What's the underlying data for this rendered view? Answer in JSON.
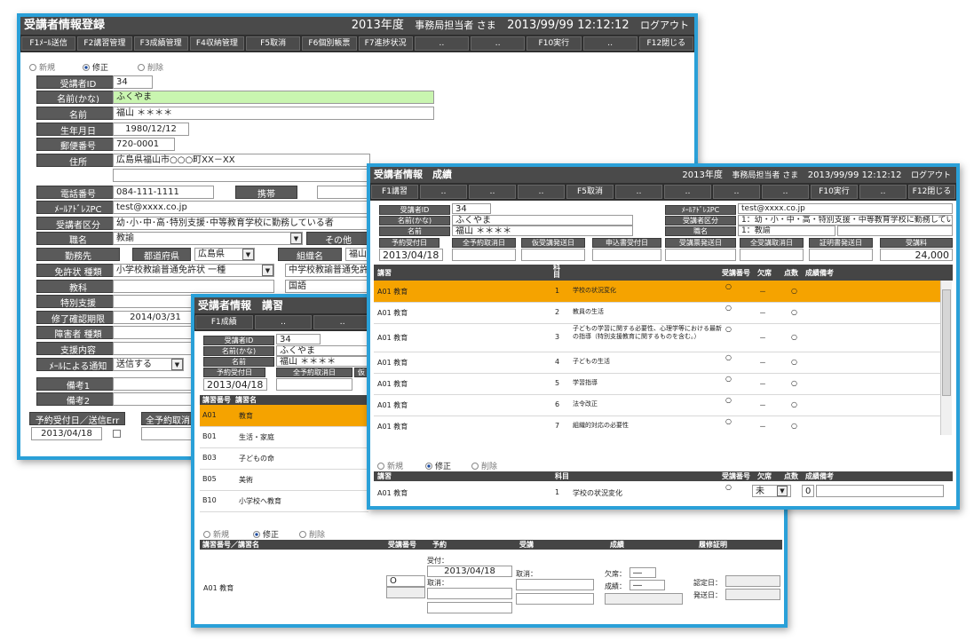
{
  "w1": {
    "title": "受講者情報登録",
    "year": "2013年度",
    "user": "事務局担当者 さま",
    "datetime": "2013/99/99 12:12:12",
    "logout": "ログアウト",
    "fkeys": [
      "F1ﾒｰﾙ送信",
      "F2講習管理",
      "F3成績管理",
      "F4収納管理",
      "F5取消",
      "F6個別帳票",
      "F7進捗状況",
      "‥",
      "‥",
      "F10実行",
      "‥",
      "F12閉じる"
    ],
    "mode": {
      "new": "新規",
      "edit": "修正",
      "delete": "削除"
    },
    "labels": {
      "id": "受講者ID",
      "kana": "名前(かな)",
      "name": "名前",
      "birth": "生年月日",
      "zip": "郵便番号",
      "address": "住所",
      "phone": "電話番号",
      "mobile": "携帯",
      "email": "ﾒｰﾙｱﾄﾞﾚｽPC",
      "category": "受講者区分",
      "job": "職名",
      "other": "その他",
      "work": "勤務先",
      "pref_label": "都道府県",
      "org_label": "組織名",
      "license": "免許状 種類",
      "subject": "教科",
      "special": "特別支援",
      "deadline": "修了確認期限",
      "disability": "障害者 種類",
      "support": "支援内容",
      "notify": "ﾒｰﾙによる通知",
      "note1": "備考1",
      "note2": "備考2",
      "reserve": "予約受付日／送信Err",
      "cancel": "全予約取消"
    },
    "values": {
      "id": "34",
      "kana": "ふくやま",
      "name": "福山 ＊＊＊＊",
      "birth": "1980/12/12",
      "zip": "720-0001",
      "address": "広島県福山市○○○町XX－XX",
      "phone": "084-111-1111",
      "email": "test@xxxx.co.jp",
      "category": "幼･小･中･高･特別支援･中等教育学校に勤務している者",
      "job": "教諭",
      "pref": "広島県",
      "org": "福山",
      "license1": "小学校教諭普通免許状 一種",
      "license2": "中学校教諭普通免許状",
      "subject2": "国語",
      "deadline": "2014/03/31",
      "notify": "送信する",
      "reserve": "2013/04/18"
    }
  },
  "w2": {
    "title": "受講者情報　成績",
    "year": "2013年度",
    "user": "事務局担当者 さま",
    "datetime": "2013/99/99 12:12:12",
    "logout": "ログアウト",
    "fkeys": [
      "F1講習",
      "‥",
      "‥",
      "‥",
      "F5取消",
      "‥",
      "‥",
      "‥",
      "‥",
      "F10実行",
      "‥",
      "F12閉じる"
    ],
    "labels": {
      "id": "受講者ID",
      "kana": "名前(かな)",
      "name": "名前",
      "email": "ﾒｰﾙｱﾄﾞﾚｽPC",
      "category": "受講者区分",
      "job": "職名",
      "reserve": "予約受付日",
      "cancel_all": "全予約取消日",
      "tentative": "仮受講発送日",
      "apply": "申込書受付日",
      "ticket": "受講票発送日",
      "cancel_attend": "全受講取消日",
      "cert": "証明書発送日",
      "fee": "受講料"
    },
    "values": {
      "id": "34",
      "kana": "ふくやま",
      "name": "福山 ＊＊＊＊",
      "email": "test@xxxx.co.jp",
      "category": "1：幼・小・中・高・特別支援・中等教育学校に勤務している者",
      "job": "1：教諭",
      "reserve": "2013/04/18",
      "fee": "24,000"
    },
    "table_header": {
      "course": "講習",
      "subj": "科目",
      "num": "受講番号",
      "absent": "欠席",
      "score": "点数",
      "note": "成績備考"
    },
    "rows": [
      {
        "course": "A01 教育",
        "no": "1",
        "subject": "学校の状況変化",
        "mark": "○",
        "absent": "－",
        "score": "○"
      },
      {
        "course": "A01 教育",
        "no": "2",
        "subject": "教員の生活",
        "mark": "○",
        "absent": "－",
        "score": "○"
      },
      {
        "course": "A01 教育",
        "no": "3",
        "subject": "子どもの学習に関する必要性、心理学等における最新の指導（特別支援教育に関するものを含む。）",
        "mark": "○",
        "absent": "－",
        "score": "○"
      },
      {
        "course": "A01 教育",
        "no": "4",
        "subject": "子どもの生活",
        "mark": "○",
        "absent": "－",
        "score": "○"
      },
      {
        "course": "A01 教育",
        "no": "5",
        "subject": "学習指導",
        "mark": "○",
        "absent": "－",
        "score": "○"
      },
      {
        "course": "A01 教育",
        "no": "6",
        "subject": "法令改正",
        "mark": "○",
        "absent": "－",
        "score": "○"
      },
      {
        "course": "A01 教育",
        "no": "7",
        "subject": "組織的対応の必要性",
        "mark": "○",
        "absent": "－",
        "score": "○"
      }
    ],
    "mode": {
      "new": "新規",
      "edit": "修正",
      "delete": "削除"
    },
    "edit_header": {
      "course": "講習",
      "subj": "科目",
      "num": "受講番号",
      "absent": "欠席",
      "score": "点数",
      "note": "成績備考"
    },
    "edit_row": {
      "course": "A01 教育",
      "no": "1",
      "subject": "学校の状況変化",
      "mark": "○",
      "absent": "未",
      "score": "0"
    }
  },
  "w3": {
    "title": "受講者情報　講習",
    "fkeys": [
      "F1成績",
      "‥",
      "‥"
    ],
    "labels": {
      "id": "受講者ID",
      "kana": "名前(かな)",
      "name": "名前",
      "reserve": "予約受付日",
      "cancel_all": "全予約取消日",
      "tentative": "仮"
    },
    "values": {
      "id": "34",
      "kana": "ふくやま",
      "name": "福山 ＊＊＊＊",
      "reserve": "2013/04/18"
    },
    "list_header": {
      "code": "講習番号",
      "name": "講習名"
    },
    "rows": [
      {
        "code": "A01",
        "name": "教育"
      },
      {
        "code": "B01",
        "name": "生活・家庭"
      },
      {
        "code": "B03",
        "name": "子どもの命"
      },
      {
        "code": "B05",
        "name": "美術"
      },
      {
        "code": "B10",
        "name": "小学校へ教育"
      }
    ],
    "mode": {
      "new": "新規",
      "edit": "修正",
      "delete": "削除"
    },
    "edit_header": {
      "course": "講習番号／講習名",
      "num": "受講番号",
      "reserve": "予約",
      "attend": "受講",
      "grade": "成績",
      "cert": "履修証明"
    },
    "edit": {
      "course": "A01 教育",
      "num": "O",
      "accept_label": "受付：",
      "accept_date": "2013/04/18",
      "cancel_label": "取消：",
      "attend_cancel": "取消：",
      "absent_label": "欠席：",
      "absent": "―",
      "grade_label": "成績：",
      "grade": "―",
      "approve_label": "認定日：",
      "send_label": "発送日："
    }
  }
}
